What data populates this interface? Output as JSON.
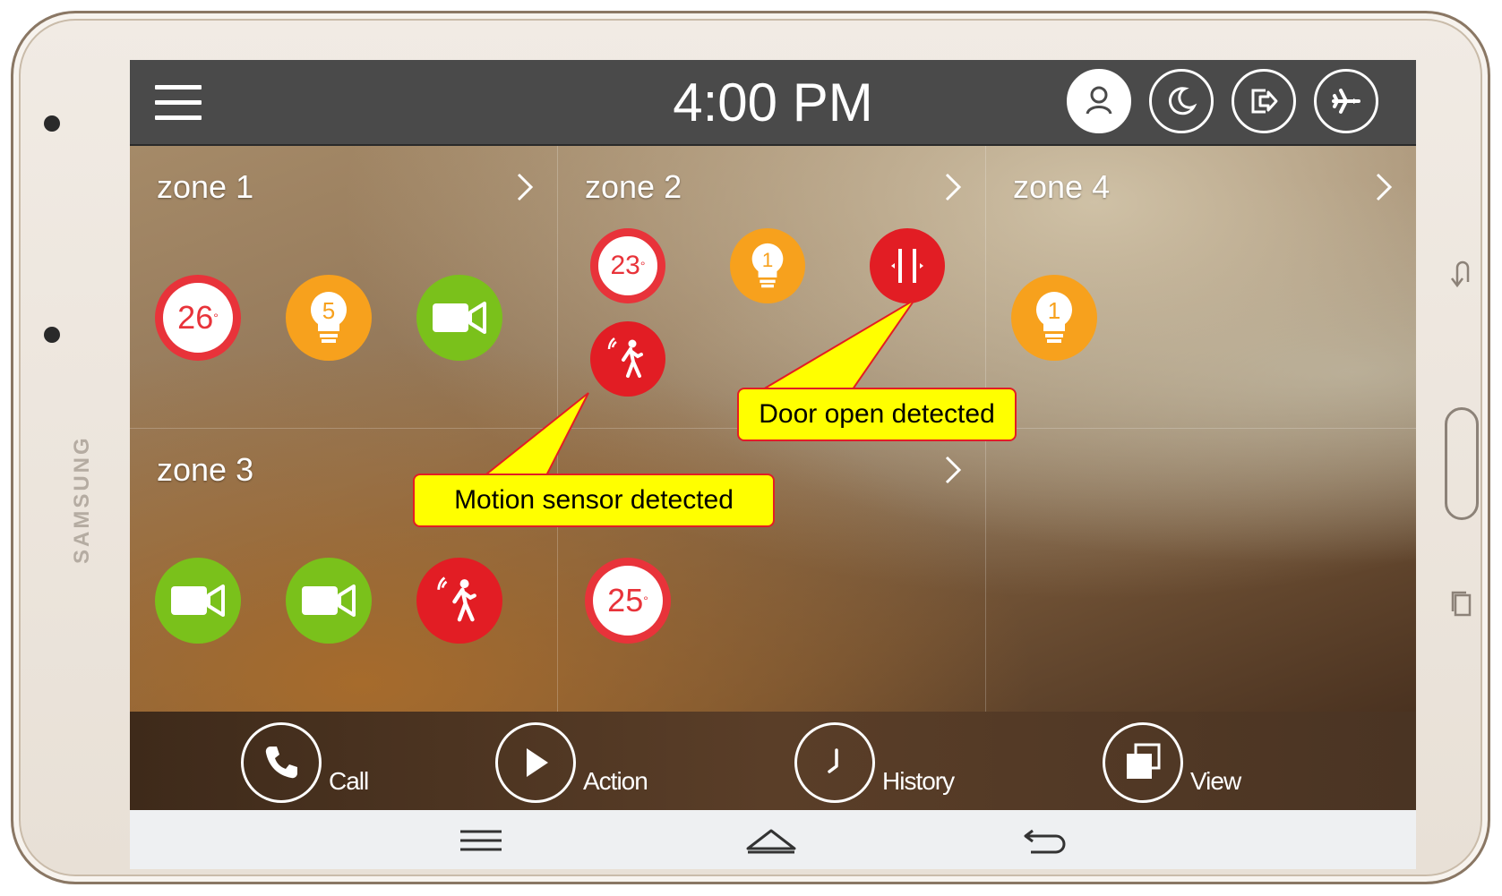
{
  "device": {
    "brand": "SAMSUNG"
  },
  "statusbar": {
    "time": "4:00 PM"
  },
  "modes": [
    "home-mode-icon",
    "night-mode-icon",
    "away-mode-icon",
    "vacation-mode-icon"
  ],
  "zones": [
    {
      "title": "zone 1",
      "devices": [
        {
          "type": "thermostat",
          "value": "26",
          "unit": "°"
        },
        {
          "type": "light",
          "value": "5"
        },
        {
          "type": "camera"
        }
      ]
    },
    {
      "title": "zone 2",
      "devices": [
        {
          "type": "thermostat",
          "value": "23",
          "unit": "°"
        },
        {
          "type": "light",
          "value": "1"
        },
        {
          "type": "door-sensor"
        },
        {
          "type": "motion-sensor"
        }
      ]
    },
    {
      "title": "zone 4",
      "devices": [
        {
          "type": "light",
          "value": "1"
        }
      ]
    },
    {
      "title": "zone 3",
      "devices": [
        {
          "type": "camera"
        },
        {
          "type": "camera"
        },
        {
          "type": "motion-sensor"
        }
      ]
    },
    {
      "title": "",
      "devices": [
        {
          "type": "thermostat",
          "value": "25",
          "unit": "°"
        }
      ]
    }
  ],
  "callouts": {
    "door": "Door open detected",
    "motion": "Motion sensor detected"
  },
  "actions": [
    {
      "label": "Call",
      "icon": "phone-icon"
    },
    {
      "label": "Action",
      "icon": "play-icon"
    },
    {
      "label": "History",
      "icon": "clock-icon"
    },
    {
      "label": "View",
      "icon": "view-icon"
    }
  ],
  "nav": [
    "recent-apps-icon",
    "home-icon",
    "back-icon"
  ],
  "colors": {
    "alarm_red": "#e21d24",
    "light_orange": "#f7a11d",
    "camera_green": "#7ac11b",
    "callout_yellow": "#ffff00",
    "statusbar_gray": "#4a4a4a"
  }
}
